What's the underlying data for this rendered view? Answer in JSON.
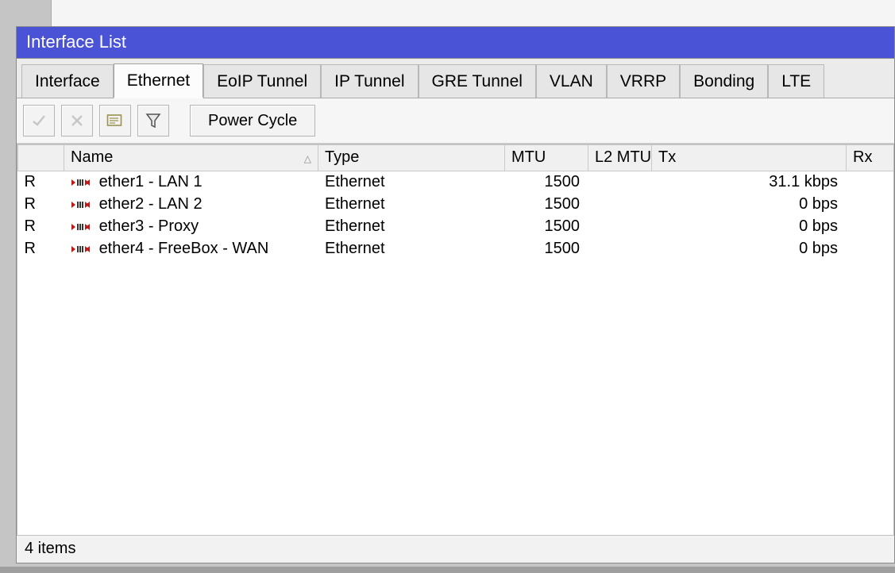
{
  "window": {
    "title": "Interface List"
  },
  "tabs": {
    "items": [
      {
        "label": "Interface"
      },
      {
        "label": "Ethernet"
      },
      {
        "label": "EoIP Tunnel"
      },
      {
        "label": "IP Tunnel"
      },
      {
        "label": "GRE Tunnel"
      },
      {
        "label": "VLAN"
      },
      {
        "label": "VRRP"
      },
      {
        "label": "Bonding"
      },
      {
        "label": "LTE"
      }
    ],
    "active_index": 1
  },
  "toolbar": {
    "enable_icon": "check-icon",
    "disable_icon": "x-icon",
    "comment_icon": "note-icon",
    "filter_icon": "funnel-icon",
    "power_cycle_label": "Power Cycle"
  },
  "columns": {
    "flag": "",
    "name": "Name",
    "type": "Type",
    "mtu": "MTU",
    "l2mtu": "L2 MTU",
    "tx": "Tx",
    "rx": "Rx"
  },
  "rows": [
    {
      "flag": "R",
      "name": "ether1 - LAN 1",
      "type": "Ethernet",
      "mtu": "1500",
      "l2mtu": "",
      "tx": "31.1 kbps"
    },
    {
      "flag": "R",
      "name": "ether2 - LAN 2",
      "type": "Ethernet",
      "mtu": "1500",
      "l2mtu": "",
      "tx": "0 bps"
    },
    {
      "flag": "R",
      "name": "ether3 - Proxy",
      "type": "Ethernet",
      "mtu": "1500",
      "l2mtu": "",
      "tx": "0 bps"
    },
    {
      "flag": "R",
      "name": "ether4 - FreeBox - WAN",
      "type": "Ethernet",
      "mtu": "1500",
      "l2mtu": "",
      "tx": "0 bps"
    }
  ],
  "status": {
    "items_label": "4 items"
  }
}
